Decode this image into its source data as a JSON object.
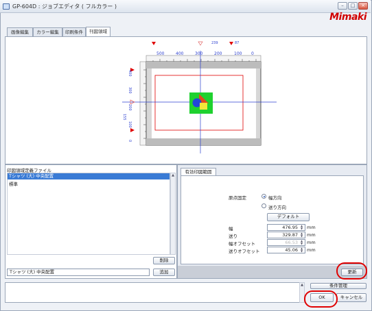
{
  "window": {
    "title": "GP-604D : ジョブエディタ ( フルカラー )",
    "logo": "Mimaki",
    "controls": [
      "–",
      "□",
      "×"
    ]
  },
  "tabs": [
    {
      "label": "画像編集",
      "active": false
    },
    {
      "label": "カラー編集",
      "active": false
    },
    {
      "label": "印刷条件",
      "active": false
    },
    {
      "label": "刊図領域",
      "active": true
    }
  ],
  "preview": {
    "top_marker_labels": [
      "239",
      "87"
    ],
    "top_ruler_ticks": [
      "500",
      "400",
      "300",
      "200",
      "100",
      "0"
    ],
    "left_ruler_ticks": [
      "400",
      "300",
      "200",
      "100",
      "0"
    ],
    "left_value": "155",
    "colors": {
      "marker_red": "#e00000",
      "marker_blue": "#2b3fd0",
      "platen_bg": "#d7d7d7",
      "frame": "#e00000",
      "image_green": "#1fd12f"
    }
  },
  "list_panel": {
    "header": "印図領域定義ファイル",
    "items": [
      {
        "label": "Tシャツ (大) 中央配置",
        "selected": true
      },
      {
        "label": "標準",
        "selected": false
      }
    ],
    "delete_button": "削除",
    "add_button": "追加",
    "name_input": "Tシャツ (大) 中央配置"
  },
  "right_panel": {
    "tab_label": "有効印図範囲",
    "origin_label": "原点固定",
    "radio_width": "幅方向",
    "radio_feed": "送り方向",
    "default_button": "デフォルト",
    "fields": [
      {
        "label": "幅",
        "value": "476.95",
        "unit": "mm",
        "disabled": false
      },
      {
        "label": "送り",
        "value": "329.87",
        "unit": "mm",
        "disabled": false
      },
      {
        "label": "幅オフセット",
        "value": "66.53",
        "unit": "mm",
        "disabled": true
      },
      {
        "label": "送りオフセット",
        "value": "45.06",
        "unit": "mm",
        "disabled": false
      }
    ],
    "update_button": "更新"
  },
  "footer": {
    "condition_button": "条件管理",
    "ok_button": "OK",
    "cancel_button": "キャンセル"
  }
}
